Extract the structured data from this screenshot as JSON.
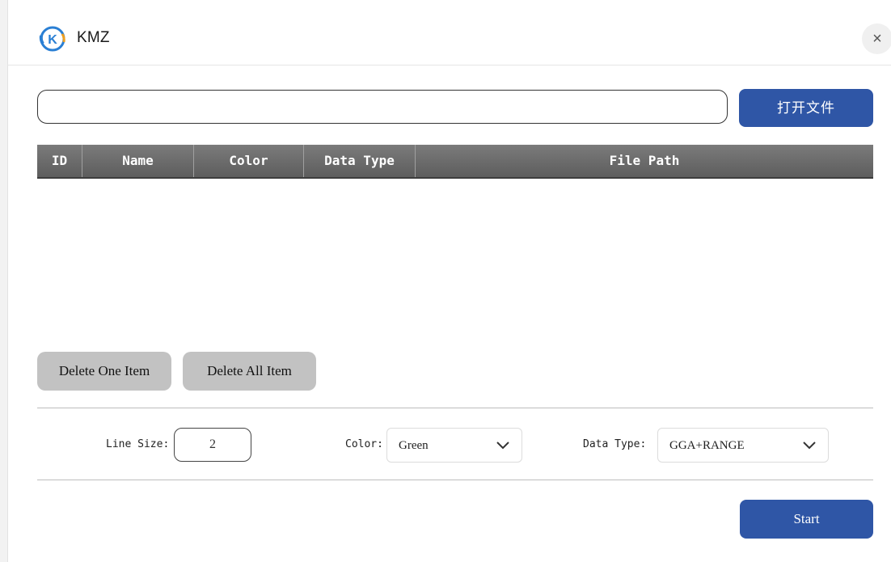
{
  "header": {
    "title": "KMZ",
    "logo_letter": "K",
    "close_symbol": "×"
  },
  "file": {
    "path_value": "",
    "open_button_label": "打开文件"
  },
  "table": {
    "columns": [
      "ID",
      "Name",
      "Color",
      "Data Type",
      "File Path"
    ],
    "rows": []
  },
  "actions": {
    "delete_one_label": "Delete One Item",
    "delete_all_label": "Delete All Item"
  },
  "settings": {
    "line_size_label": "Line Size:",
    "line_size_value": "2",
    "color_label": "Color:",
    "color_value": "Green",
    "data_type_label": "Data Type:",
    "data_type_value": "GGA+RANGE"
  },
  "start_label": "Start",
  "colors": {
    "primary": "#2f56a6",
    "header_gray": "#6b6b6b",
    "button_gray": "#c2c2c2",
    "logo_blue": "#2a7fd4"
  },
  "icons": {
    "logo": "k-logo-icon",
    "close": "close-icon",
    "dropdown": "chevron-down-icon"
  }
}
